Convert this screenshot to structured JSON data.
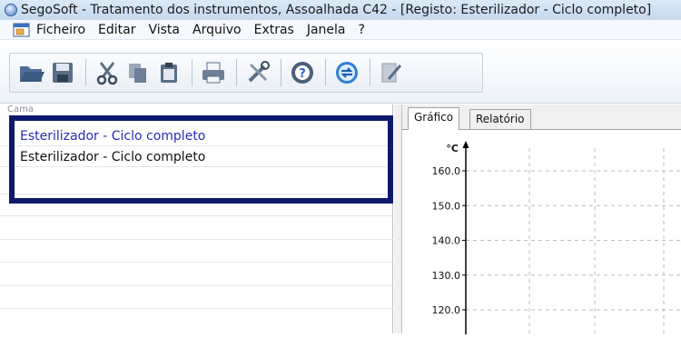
{
  "window": {
    "title": "SegoSoft - Tratamento dos instrumentos, Assoalhada C42 - [Registo: Esterilizador - Ciclo completo]"
  },
  "menu": {
    "items": [
      "Ficheiro",
      "Editar",
      "Vista",
      "Arquivo",
      "Extras",
      "Janela",
      "?"
    ]
  },
  "toolbar": {
    "buttons": [
      "open-folder-icon",
      "save-icon",
      "cut-icon",
      "copy-icon",
      "paste-icon",
      "print-icon",
      "tools-icon",
      "help-icon",
      "sync-icon",
      "edit-note-icon"
    ]
  },
  "left_pane": {
    "header": "Cama",
    "items": [
      {
        "label": "Esterilizador - Ciclo completo",
        "color": "#2a2ab8"
      },
      {
        "label": "Esterilizador - Ciclo completo",
        "color": "#111111"
      }
    ],
    "highlight_color": "#0d1a6b"
  },
  "tabs": [
    {
      "label": "Gráfico",
      "active": true
    },
    {
      "label": "Relatório",
      "active": false
    }
  ],
  "chart_data": {
    "type": "line",
    "ylabel": "°C",
    "y_ticks": [
      "160.0",
      "150.0",
      "140.0",
      "130.0",
      "120.0"
    ],
    "ylim": [
      115,
      165
    ],
    "grid": true,
    "series": []
  }
}
